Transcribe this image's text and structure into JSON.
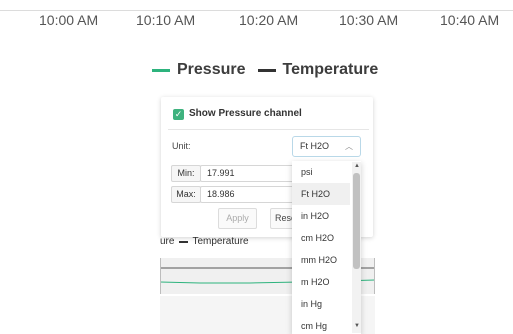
{
  "time_axis": [
    "10:00 AM",
    "10:10 AM",
    "10:20 AM",
    "10:30 AM",
    "10:40 AM"
  ],
  "legend": [
    {
      "label": "Pressure",
      "color": "#2db37d"
    },
    {
      "label": "Temperature",
      "color": "#333333"
    }
  ],
  "panel": {
    "checkbox_label": "Show Pressure channel",
    "checkbox_checked": true,
    "unit_label": "Unit:",
    "unit_value": "Ft H2O",
    "min_label": "Min:",
    "min_value": "17.991",
    "max_label": "Max:",
    "max_value": "18.986",
    "apply_label": "Apply",
    "reset_label": "Rese"
  },
  "dropdown": {
    "options": [
      "psi",
      "Ft H2O",
      "in H2O",
      "cm H2O",
      "mm H2O",
      "m H2O",
      "in Hg",
      "cm Hg"
    ],
    "selected": "Ft H2O"
  },
  "bg_legend": {
    "first_partial": "ure",
    "second": "Temperature"
  }
}
